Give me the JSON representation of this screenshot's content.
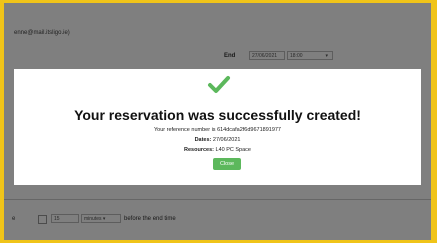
{
  "background": {
    "email_fragment": "enne@mail.itsligo.ie)",
    "end_label": "End",
    "end_date": "27/06/2021",
    "end_time": "18:00",
    "reminder_prefix": "e",
    "reminder_value": "15",
    "reminder_unit": "minutes",
    "reminder_suffix": "before the end time"
  },
  "modal": {
    "icon": "check-icon",
    "title": "Your reservation was successfully created!",
    "reference_text": "Your reference number is 614dcafa2f6d9671891977",
    "dates_label": "Dates:",
    "dates_value": "27/06/2021",
    "resources_label": "Resources:",
    "resources_value": "L40 PC Space",
    "close_label": "Close"
  },
  "colors": {
    "frame": "#f0c419",
    "success": "#5cb85c"
  }
}
